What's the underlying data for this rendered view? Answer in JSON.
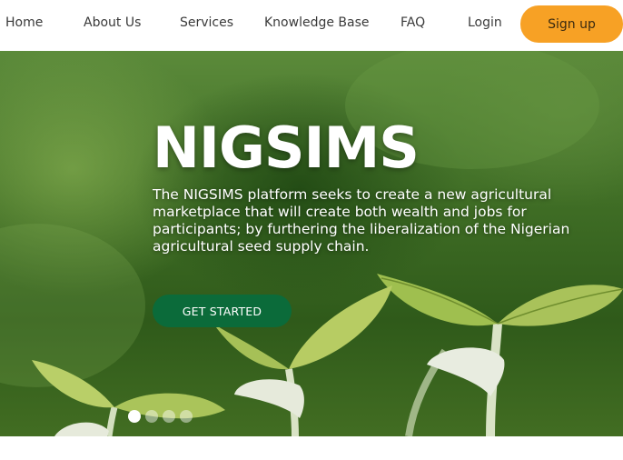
{
  "nav": {
    "items": [
      {
        "label": "Home"
      },
      {
        "label": "About Us"
      },
      {
        "label": "Services"
      },
      {
        "label": "Knowledge Base"
      },
      {
        "label": "FAQ"
      },
      {
        "label": "Login"
      }
    ],
    "signup_label": "Sign up"
  },
  "hero": {
    "title": "NIGSIMS",
    "description": "The NIGSIMS platform seeks to create a new agricultural marketplace that will create both wealth and jobs for participants; by furthering the liberalization of the Nigerian agricultural seed supply chain.",
    "cta_label": "GET STARTED",
    "slide_count": 4,
    "active_slide": 1
  },
  "colors": {
    "signup": "#f7a125",
    "cta": "#0b6b3a"
  }
}
